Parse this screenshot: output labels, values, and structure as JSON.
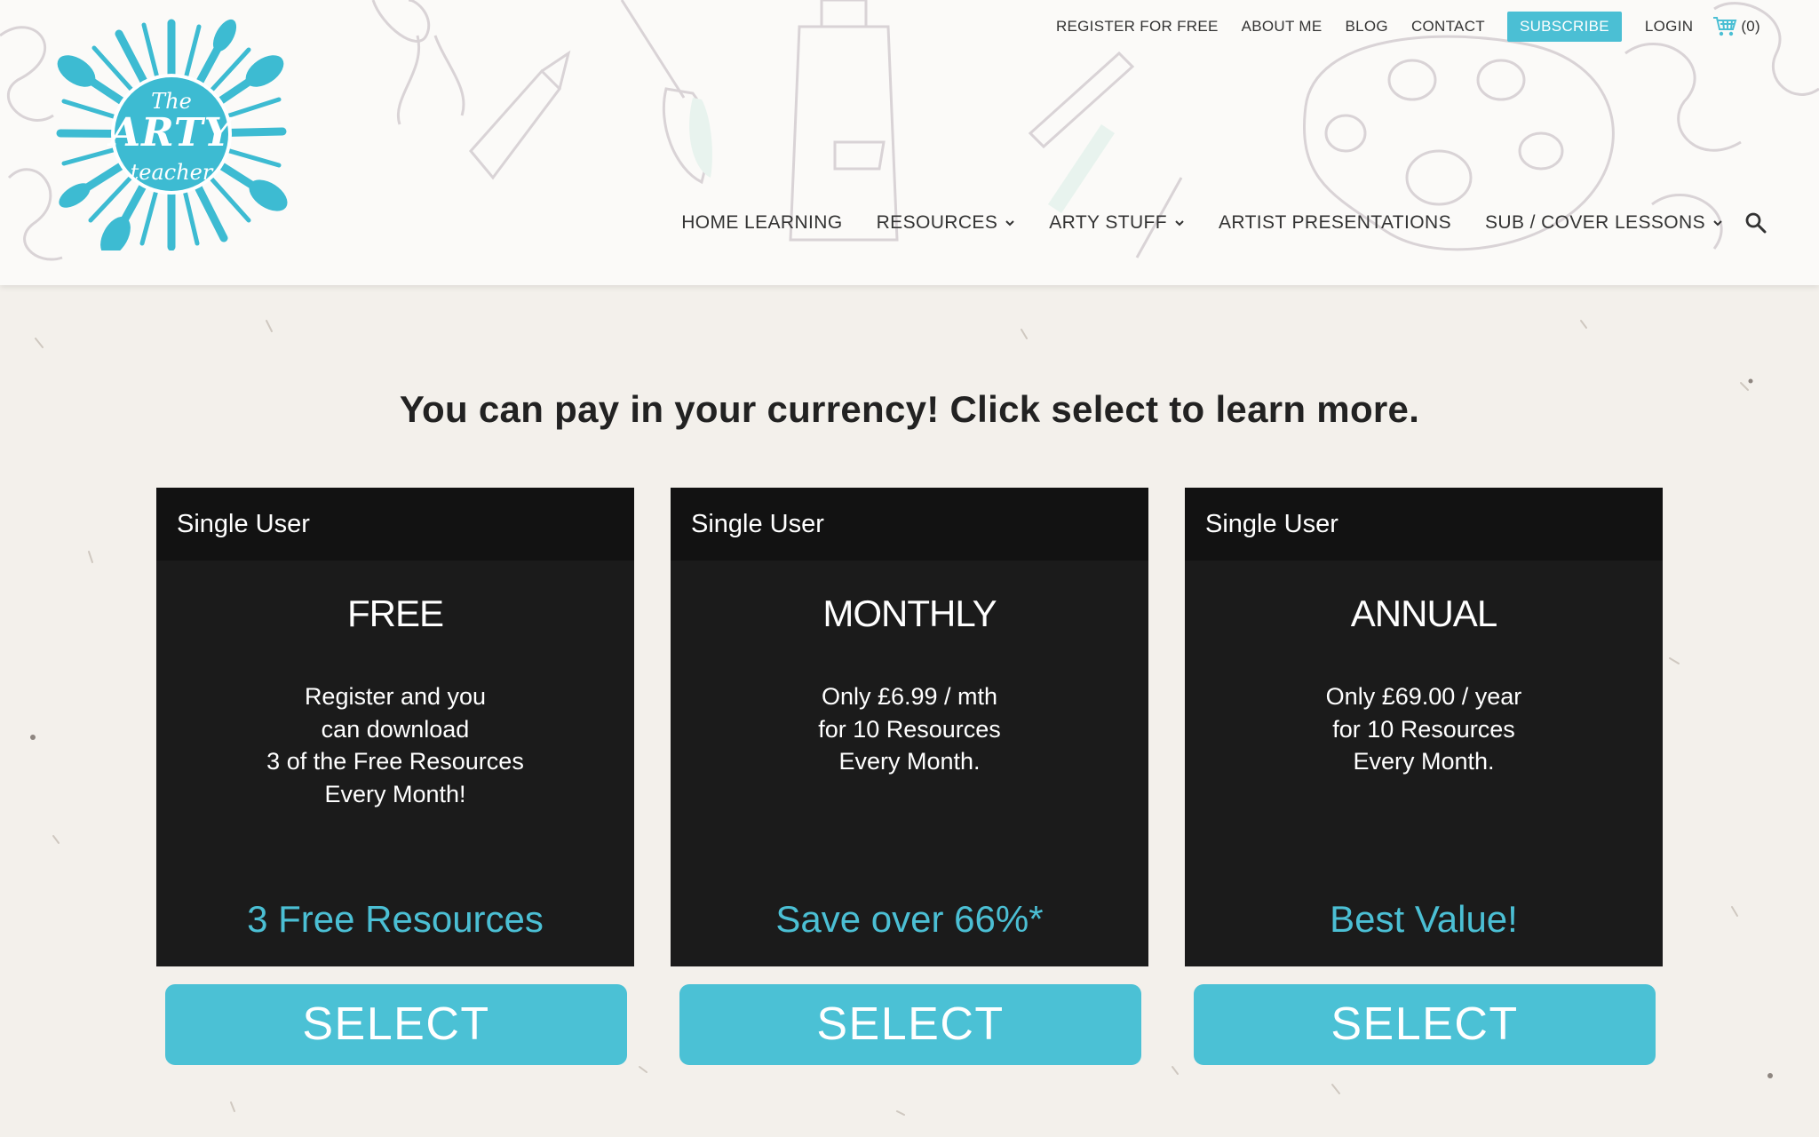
{
  "logo": {
    "line1": "The",
    "line2": "ARTY",
    "line3": "teacher"
  },
  "top_nav": {
    "register": "REGISTER FOR FREE",
    "about": "ABOUT ME",
    "blog": "BLOG",
    "contact": "CONTACT",
    "subscribe": "SUBSCRIBE",
    "login": "LOGIN",
    "cart_count": "(0)"
  },
  "main_nav": {
    "home_learning": "HOME LEARNING",
    "resources": "RESOURCES",
    "arty_stuff": "ARTY STUFF",
    "artist_presentations": "ARTIST PRESENTATIONS",
    "sub_cover": "SUB / COVER LESSONS"
  },
  "headline": "You can pay in your currency! Click select to learn more.",
  "plans": [
    {
      "header": "Single User",
      "title": "FREE",
      "desc": [
        "Register and you",
        "can download",
        "3 of the Free Resources",
        "Every Month!"
      ],
      "tag": "3 Free Resources",
      "button": "SELECT"
    },
    {
      "header": "Single User",
      "title": "MONTHLY",
      "desc": [
        "Only £6.99 / mth",
        "for 10 Resources",
        "Every Month."
      ],
      "tag": "Save over 66%*",
      "button": "SELECT"
    },
    {
      "header": "Single User",
      "title": "ANNUAL",
      "desc": [
        "Only £69.00 / year",
        "for 10 Resources",
        "Every Month."
      ],
      "tag": "Best Value!",
      "button": "SELECT"
    }
  ],
  "colors": {
    "accent": "#4bbfd4",
    "card_bg": "#1b1b1b",
    "card_head_bg": "#121212",
    "page_bg": "#f3f0eb"
  },
  "icons": {
    "cart": "cart-icon",
    "search": "search-icon",
    "chevron": "chevron-down-icon"
  }
}
